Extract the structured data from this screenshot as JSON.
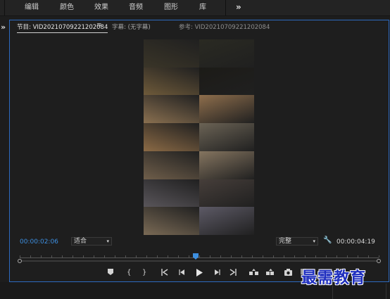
{
  "menubar": {
    "items": [
      "编辑",
      "颜色",
      "效果",
      "音频",
      "图形",
      "库"
    ],
    "more_icon": "»"
  },
  "side": {
    "expand_icon": "»"
  },
  "program_panel": {
    "tabs": [
      {
        "label": "节目: VID20210709221202084",
        "active": true
      },
      {
        "label": "字幕: (无字幕)",
        "active": false
      },
      {
        "label": "参考: VID20210709221202084",
        "active": false
      }
    ],
    "tab_menu_icon": "≡",
    "timecode_current": "00:00:02:06",
    "zoom_select": "适合",
    "quality_select": "完整",
    "timecode_duration": "00:00:04:19",
    "playhead_fraction": 0.49
  },
  "transport": {
    "icons": [
      "marker-icon",
      "mark-in-icon",
      "mark-out-icon",
      "go-to-in-icon",
      "step-back-icon",
      "play-icon",
      "step-forward-icon",
      "go-to-out-icon",
      "lift-icon",
      "extract-icon",
      "export-frame-icon",
      "add-button-icon"
    ]
  },
  "video_tiles": {
    "colors": [
      "#3a3528",
      "#2a2a22",
      "#6e5a3a",
      "#1c1b17",
      "#8a7050",
      "#8e6e4c",
      "#8b6a45",
      "#6b6355",
      "#6f5e4a",
      "#857560",
      "#59555a",
      "#463e3a",
      "#7a6a55",
      "#5d5a66"
    ]
  },
  "watermark": {
    "text": "最需教育"
  }
}
